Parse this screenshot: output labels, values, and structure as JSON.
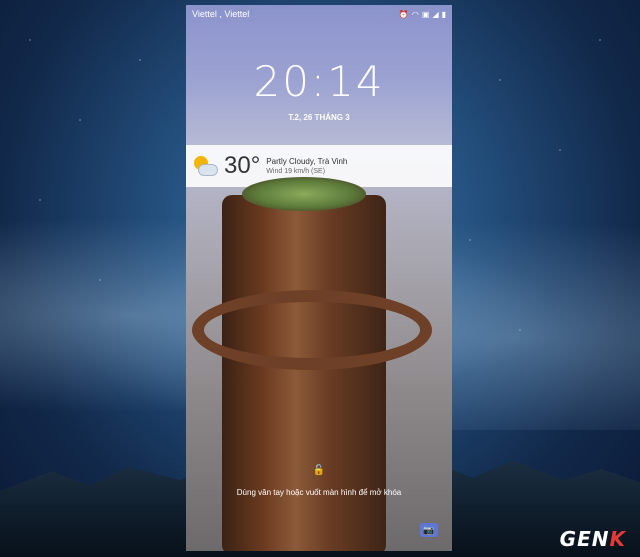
{
  "status_bar": {
    "carrier": "Viettel , Viettel",
    "icons": [
      "alarm-icon",
      "wifi-icon",
      "sim-icon",
      "signal-icon",
      "battery-icon"
    ]
  },
  "lockscreen": {
    "time": "20:14",
    "date": "T.2, 26 THÁNG 3"
  },
  "weather": {
    "icon": "partly-cloudy-icon",
    "temperature": "30°",
    "condition_location": "Partly Cloudy, Trà Vinh",
    "wind": "Wind 19 km/h (SE)"
  },
  "unlock": {
    "hint": "Dùng vân tay hoặc vuốt màn hình để mở khóa",
    "lock_icon": "lock-icon",
    "camera_icon": "camera-icon"
  },
  "watermark": {
    "brand_main": "GEN",
    "brand_accent": "K"
  }
}
